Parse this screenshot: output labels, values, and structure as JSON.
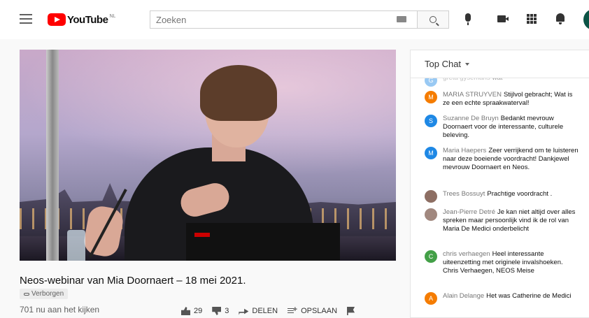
{
  "header": {
    "logo_text": "YouTube",
    "logo_region": "NL",
    "search_placeholder": "Zoeken"
  },
  "video": {
    "title": "Neos-webinar van Mia Doornaert – 18 mei 2021.",
    "visibility_badge": "Verborgen",
    "viewers": "701 nu aan het kijken",
    "like_count": "29",
    "dislike_count": "3",
    "share_label": "DELEN",
    "save_label": "OPSLAAN"
  },
  "chat": {
    "header_label": "Top Chat",
    "messages": [
      {
        "author": "greta gysemans",
        "text": "wat",
        "initial": "G",
        "color": "#1e88e5",
        "faded": true
      },
      {
        "author": "MARIA STRUYVEN",
        "text": "Stijlvol gebracht; Wat is ze een echte spraakwaterval!",
        "initial": "M",
        "color": "#f57c00"
      },
      {
        "author": "Suzanne De Bruyn",
        "text": "Bedankt mevrouw Doornaert voor de interessante, culturele beleving.",
        "initial": "S",
        "color": "#1e88e5"
      },
      {
        "author": "Maria Haepers",
        "text": "Zeer verrijkend om te luisteren naar deze boeiende voordracht! Dankjewel mevrouw Doornaert en Neos.",
        "initial": "M",
        "color": "#1e88e5"
      },
      {
        "author": "Trees Bossuyt",
        "text": "Prachtige voordracht .",
        "initial": "",
        "color": "#8d6e63"
      },
      {
        "author": "Jean-Pierre Detré",
        "text": "Je kan niet altijd over alles spreken maar persoonlijk vind ik de rol van Maria De Medici onderbelicht",
        "initial": "",
        "color": "#a1887f"
      },
      {
        "author": "chris verhaegen",
        "text": "Heel interessante uiteenzetting met originele invalshoeken. Chris Verhaegen, NEOS Meise",
        "initial": "C",
        "color": "#43a047"
      },
      {
        "author": "Alain Delange",
        "text": "Het was Catherine de Medici",
        "initial": "A",
        "color": "#f57c00"
      }
    ]
  }
}
